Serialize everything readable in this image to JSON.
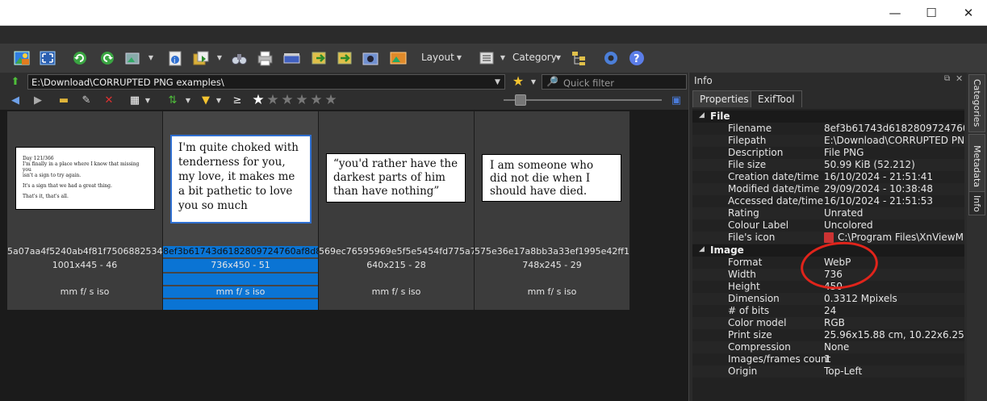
{
  "window": {
    "controls": {
      "minimize": "—",
      "maximize": "☐",
      "close": "✕"
    }
  },
  "toolbar": {
    "icons": [
      "open-icon",
      "fullscreen-icon",
      "rotate-left-icon",
      "rotate-right-icon",
      "convert-icon",
      "properties-icon",
      "copy-to-icon",
      "binoculars-icon",
      "print-icon",
      "scanner-icon",
      "move-icon",
      "export-icon",
      "capture-icon",
      "slideshow-icon",
      "settings-icon",
      "help-icon"
    ],
    "layout_label": "Layout",
    "category_label": "Category"
  },
  "pathbar": {
    "path": "E:\\Download\\CORRUPTED PNG examples\\",
    "quick_filter_placeholder": "Quick filter"
  },
  "navbar": {
    "gte_symbol": "≥",
    "rating_stars": [
      "★",
      "★",
      "★",
      "★",
      "★",
      "★"
    ]
  },
  "thumbnails": [
    {
      "filename": "5a07aa4f5240ab4f81f7506882534a...",
      "dims": "1001x445 - 46",
      "exif": "mm f/ s iso",
      "selected": false,
      "preview_lines": [
        "Day 121/366",
        "I'm finally in a place where I know that missing you",
        "isn't a sign to try again.",
        "It's a sign that we had a great thing.",
        "That's it, that's all."
      ]
    },
    {
      "filename": "8ef3b61743d6182809724760af8d87...",
      "dims": "736x450 - 51",
      "exif": "mm f/ s iso",
      "selected": true,
      "preview_text": "I'm quite choked with tenderness for you, my love, it makes me a bit pathetic to love you so much"
    },
    {
      "filename": "569ec76595969e5f5e5454fd775a79...",
      "dims": "640x215 - 28",
      "exif": "mm f/ s iso",
      "selected": false,
      "preview_text": "“you'd rather have the darkest parts of him than have nothing”"
    },
    {
      "filename": "575e36e17a8bb3a33ef1995e42ff10...",
      "dims": "748x245 - 29",
      "exif": "mm f/ s iso",
      "selected": false,
      "preview_text": "I am someone who did not die when I should have died."
    }
  ],
  "info": {
    "title": "Info",
    "tabs": [
      "Properties",
      "ExifTool"
    ],
    "file_section": "File",
    "file_rows": [
      {
        "k": "Filename",
        "v": "8ef3b61743d6182809724760af8d87..."
      },
      {
        "k": "Filepath",
        "v": "E:\\Download\\CORRUPTED PNG examples\\"
      },
      {
        "k": "Description",
        "v": "File PNG"
      },
      {
        "k": "File size",
        "v": "50.99 KiB (52.212)"
      },
      {
        "k": "Creation date/time",
        "v": "16/10/2024 - 21:51:41"
      },
      {
        "k": "Modified date/time",
        "v": "29/09/2024 - 10:38:48"
      },
      {
        "k": "Accessed date/time",
        "v": "16/10/2024 - 21:51:53"
      },
      {
        "k": "Rating",
        "v": "Unrated"
      },
      {
        "k": "Colour Label",
        "v": "Uncolored"
      },
      {
        "k": "File's icon",
        "v": "C:\\Program Files\\XnViewMP\\"
      }
    ],
    "image_section": "Image",
    "image_rows": [
      {
        "k": "Format",
        "v": "WebP"
      },
      {
        "k": "Width",
        "v": "736"
      },
      {
        "k": "Height",
        "v": "450"
      },
      {
        "k": "Dimension",
        "v": "0.3312 Mpixels"
      },
      {
        "k": "# of bits",
        "v": "24"
      },
      {
        "k": "Color model",
        "v": "RGB"
      },
      {
        "k": "Print size",
        "v": "25.96x15.88 cm, 10.22x6.25 inches"
      },
      {
        "k": "Compression",
        "v": "None"
      },
      {
        "k": "Images/frames count",
        "v": "1"
      },
      {
        "k": "Origin",
        "v": "Top-Left"
      }
    ]
  },
  "side_tabs": [
    "Categories",
    "Metadata",
    "Info"
  ]
}
